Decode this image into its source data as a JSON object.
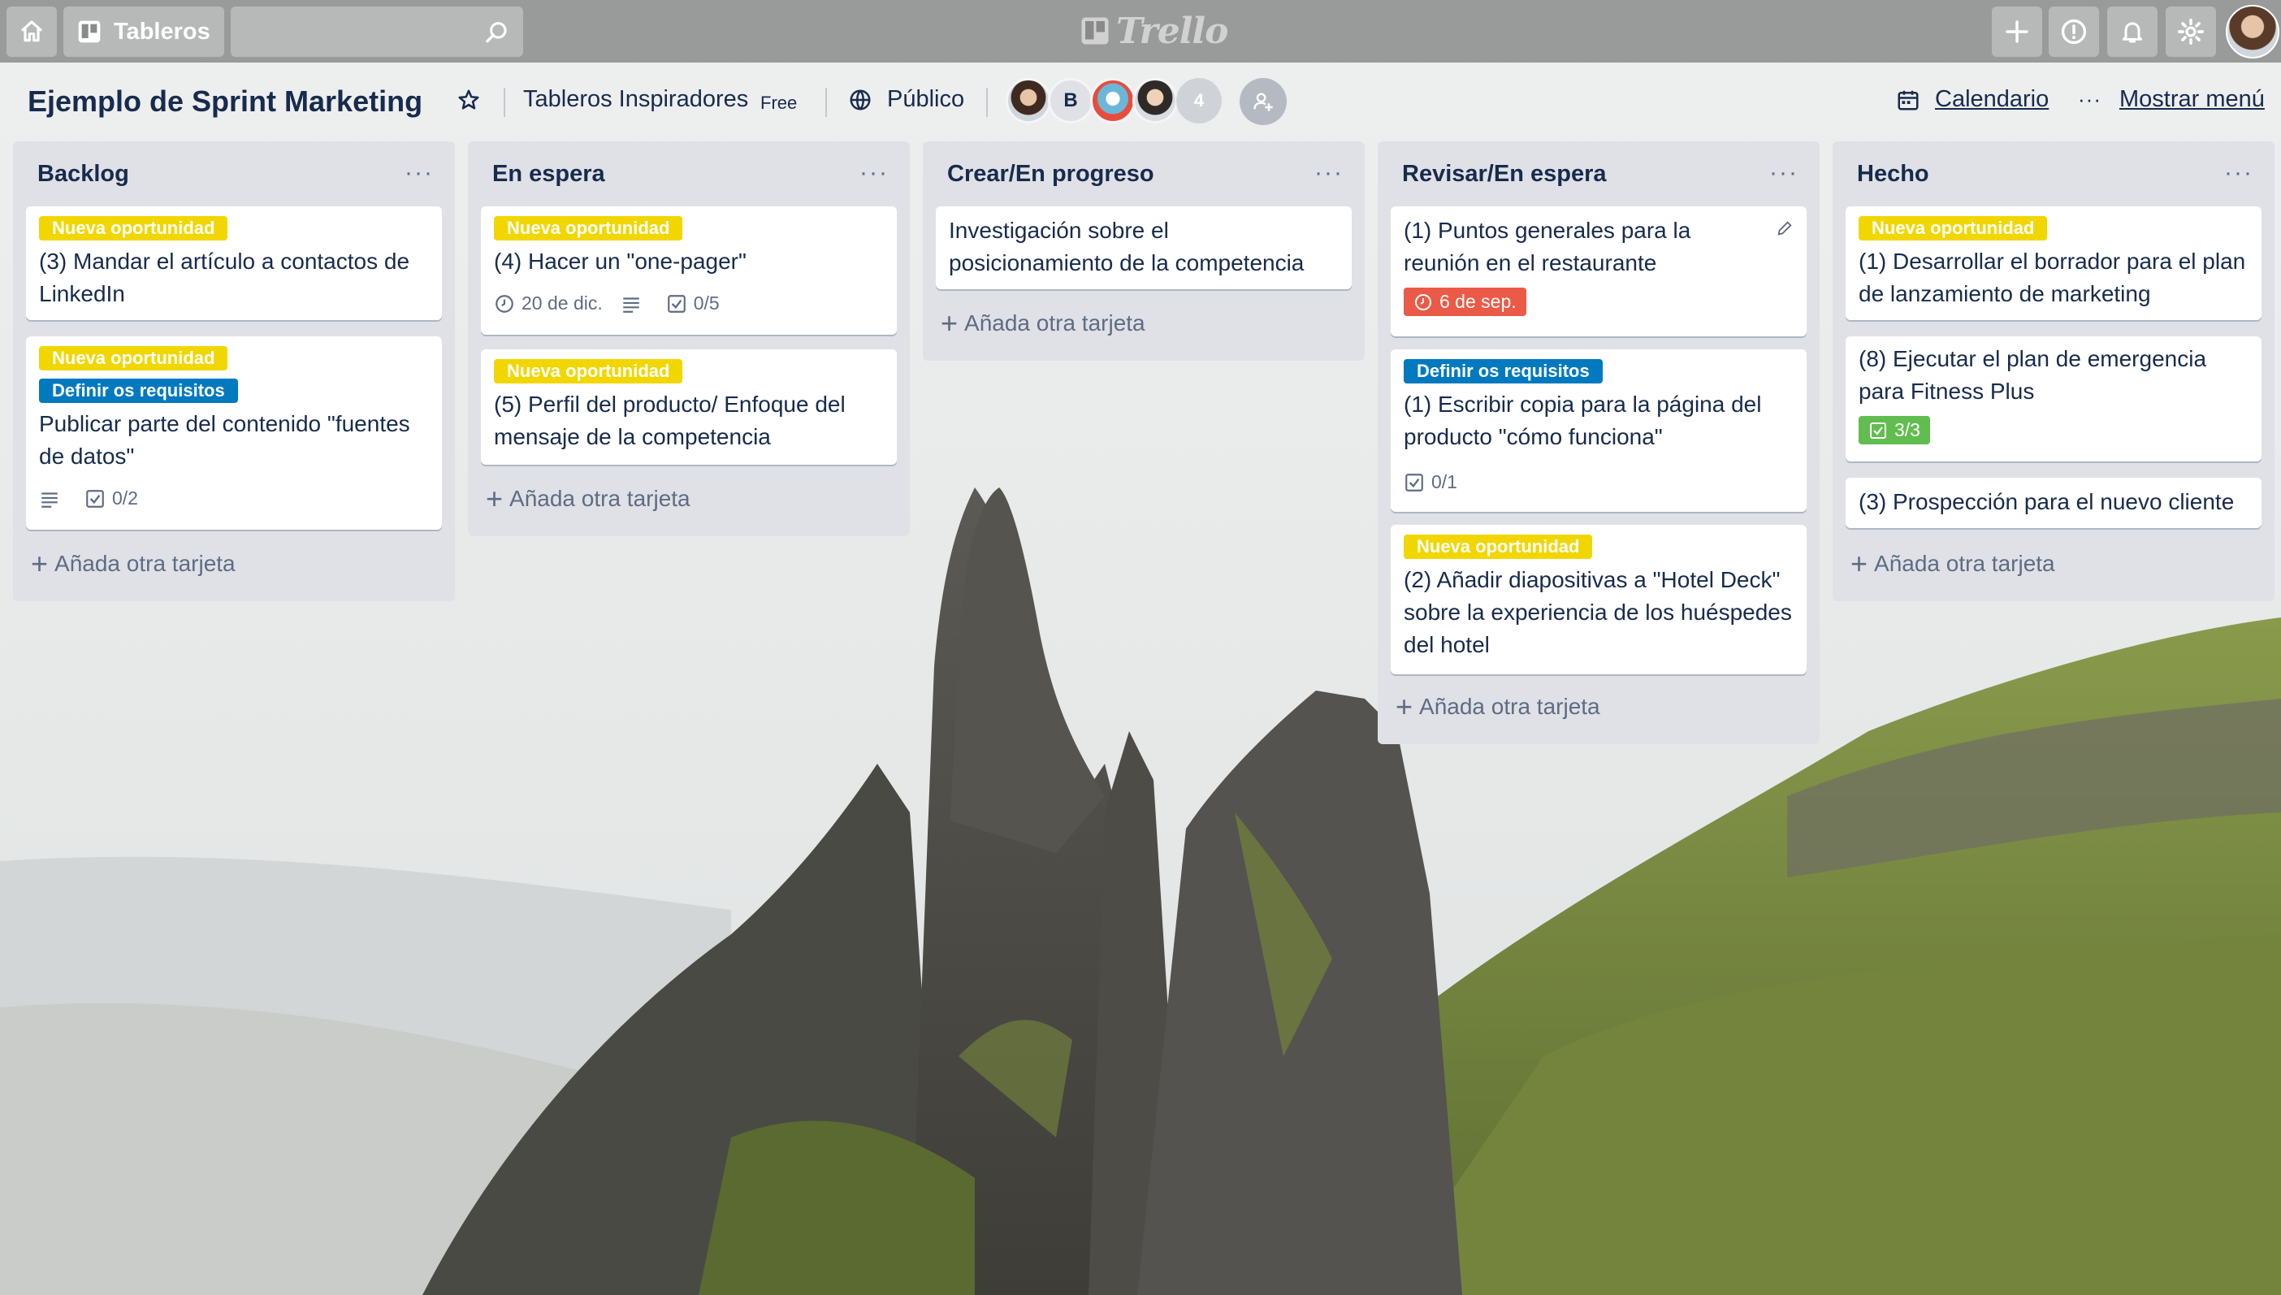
{
  "topbar": {
    "home_icon": "home-icon",
    "boards_label": "Tableros",
    "search_placeholder": "",
    "logo_text": "Trello",
    "plus_icon": "plus-icon",
    "info_icon": "info-icon",
    "bell_icon": "bell-icon",
    "gear_icon": "gear-icon"
  },
  "board": {
    "title": "Ejemplo de Sprint Marketing",
    "team": "Tableros Inspiradores",
    "plan": "Free",
    "visibility": "Público",
    "member_extra_count": "4",
    "member_initial": "B",
    "calendar_label": "Calendario",
    "menu_label": "Mostrar menú"
  },
  "colors": {
    "label_yellow": "#f2d600",
    "label_blue": "#0079bf",
    "due_overdue": "#eb5a46",
    "checklist_done": "#61bd4f"
  },
  "add_card_label": "Añada otra tarjeta",
  "lists": [
    {
      "title": "Backlog",
      "cards": [
        {
          "labels": [
            "Nueva oportunidad"
          ],
          "title": "(3) Mandar el artículo a contactos de LinkedIn"
        },
        {
          "labels": [
            "Nueva oportunidad",
            "Definir os requisitos"
          ],
          "title": "Publicar parte del contenido \"fuentes de datos\"",
          "checklist": "0/2"
        }
      ]
    },
    {
      "title": "En espera",
      "cards": [
        {
          "labels": [
            "Nueva oportunidad"
          ],
          "title": "(4) Hacer un \"one-pager\"",
          "due": "20 de dic.",
          "checklist": "0/5"
        },
        {
          "labels": [
            "Nueva oportunidad"
          ],
          "title": "(5) Perfil del producto/ Enfoque del mensaje de la competencia"
        }
      ]
    },
    {
      "title": "Crear/En progreso",
      "cards": [
        {
          "labels": [],
          "title": "Investigación sobre el posicionamiento de la competencia"
        }
      ]
    },
    {
      "title": "Revisar/En espera",
      "cards": [
        {
          "labels": [],
          "title": "(1) Puntos generales para la reunión en el restaurante",
          "due": "6 de sep."
        },
        {
          "labels": [
            "Definir os requisitos"
          ],
          "title": "(1) Escribir copia para la página del producto \"cómo funciona\"",
          "checklist": "0/1"
        },
        {
          "labels": [
            "Nueva oportunidad"
          ],
          "title": "(2) Añadir diapositivas a \"Hotel Deck\" sobre la experiencia de los huéspedes del hotel"
        }
      ]
    },
    {
      "title": "Hecho",
      "cards": [
        {
          "labels": [
            "Nueva oportunidad"
          ],
          "title": "(1) Desarrollar el borrador para el plan de lanzamiento de marketing"
        },
        {
          "labels": [],
          "title": "(8) Ejecutar el plan de emergencia para Fitness Plus",
          "checklist": "3/3"
        },
        {
          "labels": [],
          "title": "(3) Prospección para el nuevo cliente"
        }
      ]
    }
  ]
}
